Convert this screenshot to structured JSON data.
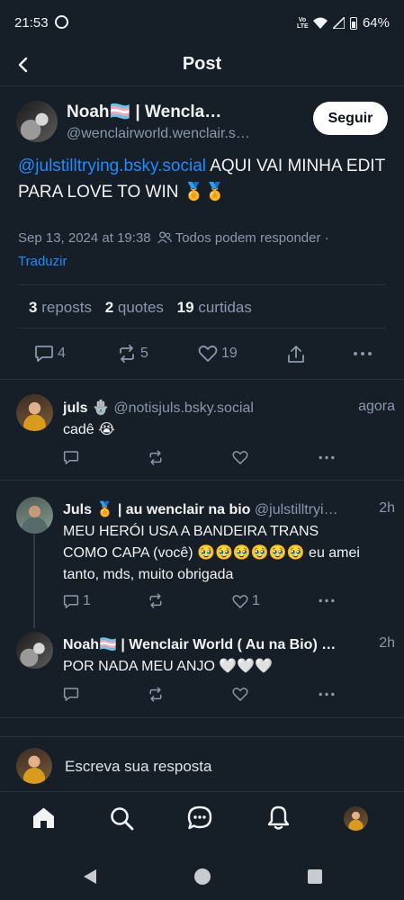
{
  "status_bar": {
    "time": "21:53",
    "network": "Vo LTE",
    "battery": "64%"
  },
  "header": {
    "title": "Post"
  },
  "main_post": {
    "author_name": "Noah🏳️‍⚧️ | Wencla…",
    "author_handle": "@wenclairworld.wenclair.s…",
    "follow_label": "Seguir",
    "mention": "@julstilltrying.bsky.social",
    "text": " AQUI VAI MINHA EDIT PARA LOVE TO WIN 🏅🏅",
    "timestamp": "Sep 13, 2024 at 19:38",
    "reply_setting": "Todos podem responder",
    "separator": "·",
    "translate_label": "Traduzir",
    "stats": {
      "reposts_count": "3",
      "reposts_label": "reposts",
      "quotes_count": "2",
      "quotes_label": "quotes",
      "likes_count": "19",
      "likes_label": "curtidas"
    },
    "actions": {
      "reply_count": "4",
      "repost_count": "5",
      "like_count": "19"
    }
  },
  "replies": [
    {
      "name": "juls 🪬",
      "handle": "@notisjuls.bsky.social",
      "time": "agora",
      "text": "cadê 😭",
      "reply_count": "",
      "like_count": ""
    },
    {
      "name": "Juls 🏅 | au wenclair na bio",
      "handle": "@julstilltryi…",
      "time": "2h",
      "text": "MEU HERÓI USA A BANDEIRA TRANS COMO CAPA (você) 🥹🥹🥹🥹🥹🥹 eu amei tanto, mds, muito obrigada",
      "reply_count": "1",
      "like_count": "1"
    },
    {
      "name": "Noah🏳️‍⚧️ | Wenclair World ( Au na Bio) …",
      "handle": "",
      "time": "2h",
      "text": "POR NADA MEU ANJO 🤍🤍🤍",
      "reply_count": "",
      "like_count": ""
    }
  ],
  "composer": {
    "placeholder": "Escreva sua resposta"
  },
  "bottom_nav": [
    "home-icon",
    "search-icon",
    "chat-icon",
    "notifications-icon",
    "profile-avatar"
  ],
  "colors": {
    "background": "#161e27",
    "accent": "#208bfe",
    "muted": "#8a98ac"
  }
}
